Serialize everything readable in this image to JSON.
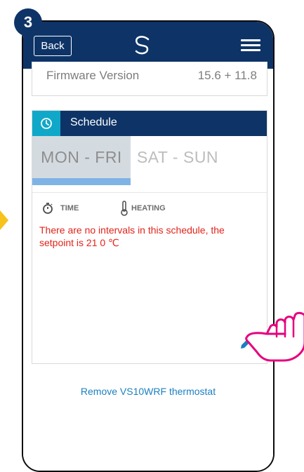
{
  "step": "3",
  "header": {
    "back_label": "Back",
    "logo_icon": "s-logo-icon",
    "menu_icon": "hamburger-menu-icon"
  },
  "firmware": {
    "label": "Firmware Version",
    "value": "15.6 + 11.8"
  },
  "schedule": {
    "title": "Schedule",
    "tabs": [
      {
        "label": "MON - FRI",
        "active": true
      },
      {
        "label": "SAT - SUN",
        "active": false
      }
    ],
    "columns": {
      "time": "TIME",
      "heating": "HEATING"
    },
    "message": "There are no intervals in this schedule, the setpoint is 21 0 ℃"
  },
  "remove_link": "Remove VS10WRF thermostat",
  "colors": {
    "header_navy": "#0e3467",
    "accent_cyan": "#10a8c8",
    "active_tab_bar": "#7fb3e6",
    "warning_red": "#e2231a",
    "link_blue": "#1b7fc1",
    "hand_magenta": "#e6007e",
    "arrow_yellow": "#f7c21c"
  }
}
